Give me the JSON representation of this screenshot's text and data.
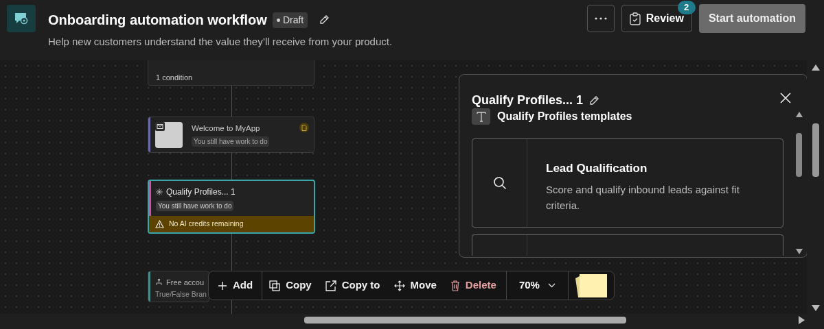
{
  "header": {
    "title": "Onboarding automation workflow",
    "status": "Draft",
    "description": "Help new customers understand the value they’ll receive from your product.",
    "review": {
      "label": "Review",
      "count": "2"
    },
    "primary_button": "Start automation"
  },
  "canvas": {
    "nodes": [
      {
        "kind": "trigger",
        "subtitle": "1 condition",
        "selected": false
      },
      {
        "kind": "email",
        "title": "Welcome to MyApp",
        "status": "You still have work to do",
        "selected": false
      },
      {
        "kind": "ai",
        "title": "Qualify Profiles... 1",
        "status": "You still have work to do",
        "warning": "No AI credits remaining",
        "selected": true
      },
      {
        "kind": "branch",
        "title": "Free accou",
        "subtitle": "True/False Bran",
        "selected": false
      }
    ]
  },
  "panel": {
    "title": "Qualify Profiles... 1",
    "subtitle": "Qualify Profiles templates",
    "templates": [
      {
        "title": "Lead Qualification",
        "description": "Score and qualify inbound leads against fit criteria."
      }
    ]
  },
  "toolbar": {
    "actions": [
      {
        "kind": "add",
        "label": "Add"
      },
      {
        "kind": "copy",
        "label": "Copy"
      },
      {
        "kind": "copy_to",
        "label": "Copy to"
      },
      {
        "kind": "move",
        "label": "Move"
      },
      {
        "kind": "delete",
        "label": "Delete"
      }
    ],
    "zoom": "70%"
  }
}
